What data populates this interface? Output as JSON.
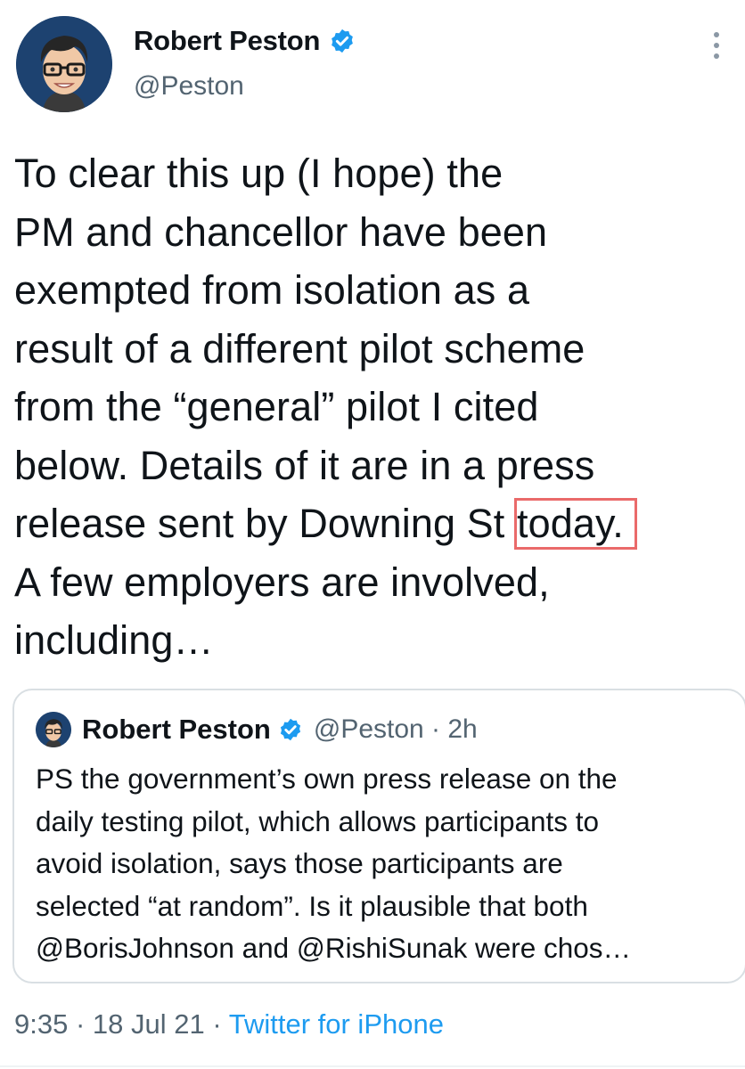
{
  "author": {
    "display_name": "Robert Peston",
    "handle": "@Peston",
    "verified_icon": "verified-badge-icon",
    "avatar_icon": "cartoon-avatar-icon"
  },
  "tweet": {
    "lines": [
      "To clear this up (I hope) the",
      "PM and chancellor have been",
      "exempted from isolation as a",
      "result of a different pilot scheme",
      "from the “general” pilot I cited",
      "below. Details of it are in a press",
      "release sent by Downing St ",
      "today.",
      "A few employers are involved,",
      "including…"
    ],
    "highlight_color": "#ea6a6a"
  },
  "quoted_tweet": {
    "display_name": "Robert Peston",
    "handle_time": "@Peston · 2h",
    "lines": [
      "PS the government’s own press release on the",
      "daily testing pilot, which allows participants to",
      "avoid isolation, says those participants are",
      "selected “at random”. Is it plausible that both",
      "@BorisJohnson and @RishiSunak were chos…"
    ]
  },
  "meta": {
    "time": "9:35",
    "sep1": " · ",
    "date": "18 Jul 21",
    "sep2": " · ",
    "source": "Twitter for iPhone"
  },
  "colors": {
    "text": "#0f1419",
    "secondary": "#536471",
    "link": "#1d9bf0",
    "verified": "#1d9bf0",
    "avatar_bg": "#1d4270"
  }
}
